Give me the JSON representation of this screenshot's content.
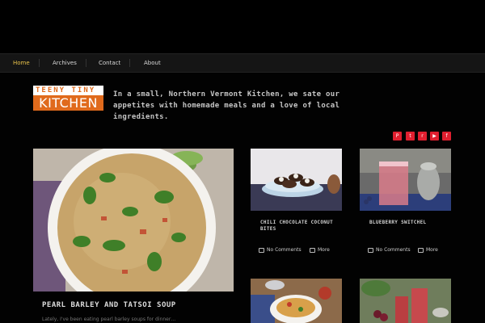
{
  "nav": {
    "items": [
      {
        "label": "Home",
        "active": true
      },
      {
        "label": "Archives",
        "active": false
      },
      {
        "label": "Contact",
        "active": false
      },
      {
        "label": "About",
        "active": false
      }
    ]
  },
  "header": {
    "logo_top": "TEENY TINY",
    "logo_bottom": "KITCHEN",
    "tagline": "In a small, Northern Vermont Kitchen, we sate our appetites with homemade meals and a love of local ingredients."
  },
  "social": {
    "icons": [
      "pinterest-icon",
      "twitter-icon",
      "rss-icon",
      "youtube-icon",
      "facebook-icon"
    ],
    "glyphs": [
      "P",
      "t",
      "r",
      "▶",
      "f"
    ],
    "color": "#e01f2f"
  },
  "featured": {
    "title": "PEARL BARLEY AND TATSOI SOUP",
    "excerpt": "Lately, I've been eating pearl barley soups for dinner…"
  },
  "posts": [
    {
      "title": "CHILI CHOCOLATE COCONUT BITES",
      "comments": "No Comments",
      "more": "More"
    },
    {
      "title": "BLUEBERRY SWITCHEL",
      "comments": "No Comments",
      "more": "More"
    }
  ],
  "colors": {
    "accent": "#e8c24a",
    "logo_orange": "#e06a1c"
  }
}
